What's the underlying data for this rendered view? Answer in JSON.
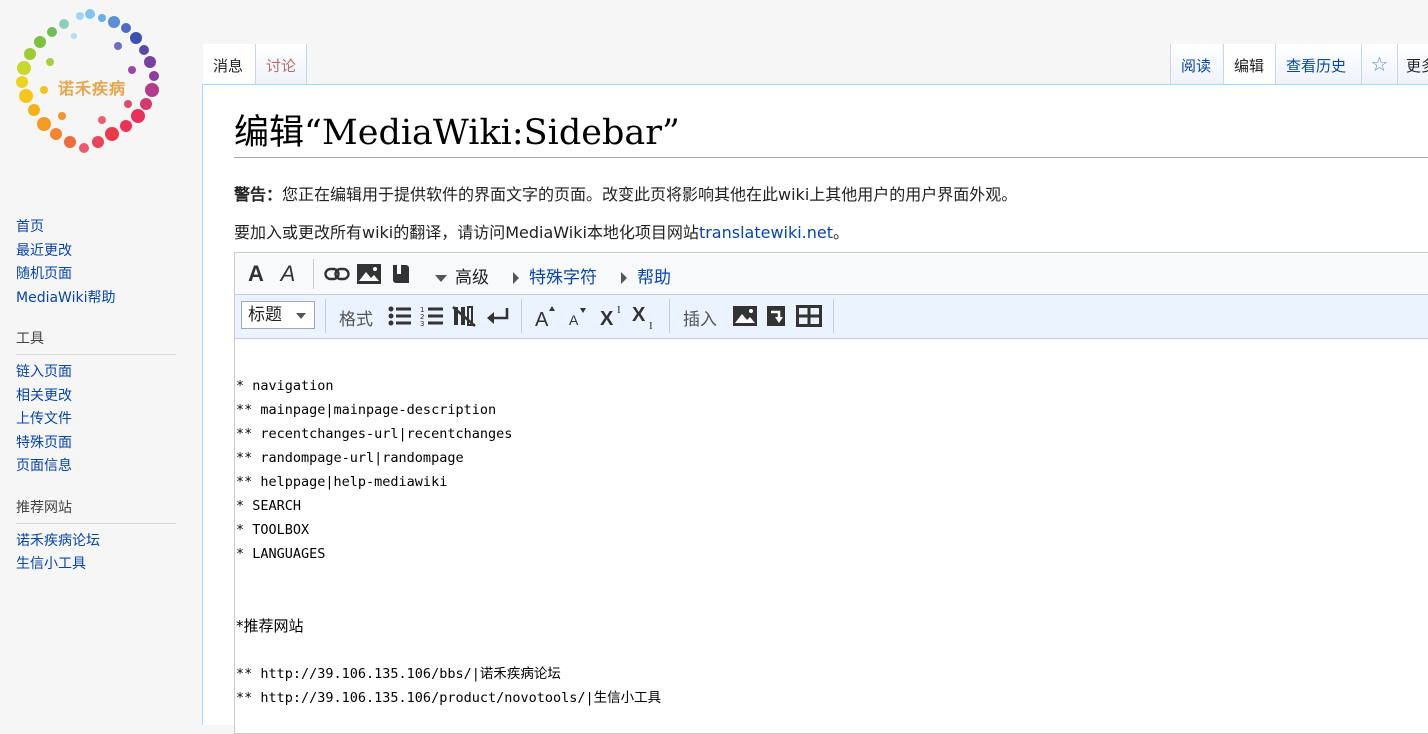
{
  "logo": {
    "text": "诺禾疾病"
  },
  "sidebar": {
    "navigation": [
      {
        "label": "首页"
      },
      {
        "label": "最近更改"
      },
      {
        "label": "随机页面"
      },
      {
        "label": "MediaWiki帮助"
      }
    ],
    "tools": {
      "heading": "工具",
      "items": [
        {
          "label": "链入页面"
        },
        {
          "label": "相关更改"
        },
        {
          "label": "上传文件"
        },
        {
          "label": "特殊页面"
        },
        {
          "label": "页面信息"
        }
      ]
    },
    "sites": {
      "heading": "推荐网站",
      "items": [
        {
          "label": "诺禾疾病论坛"
        },
        {
          "label": "生信小工具"
        }
      ]
    }
  },
  "tabs": {
    "page": "消息",
    "talk": "讨论",
    "read": "阅读",
    "edit": "编辑",
    "history": "查看历史",
    "watch_icon": "star-outline",
    "more": "更多"
  },
  "page": {
    "title": "编辑“MediaWiki:Sidebar”",
    "warning_label": "警告：",
    "warning_text": "您正在编辑用于提供软件的界面文字的页面。改变此页将影响其他在此wiki上其他用户的用户界面外观。",
    "translate_text": "要加入或更改所有wiki的翻译，请访问MediaWiki本地化项目网站",
    "translate_link": "translatewiki.net",
    "translate_suffix": "。"
  },
  "editor": {
    "toolbar1": {
      "bold_icon": "bold",
      "italic_icon": "italic",
      "link_icon": "link",
      "image_icon": "image",
      "reference_icon": "book",
      "advanced": "高级",
      "special_chars": "特殊字符",
      "help": "帮助"
    },
    "toolbar2": {
      "heading_select": "标题",
      "format_label": "格式",
      "insert_label": "插入"
    },
    "lines": [
      "* navigation",
      "** mainpage|mainpage-description",
      "** recentchanges-url|recentchanges",
      "** randompage-url|randompage",
      "** helppage|help-mediawiki",
      "* SEARCH",
      "* TOOLBOX",
      "* LANGUAGES",
      "",
      "",
      "*推荐网站",
      "",
      "** http://39.106.135.106/bbs/|诺禾疾病论坛",
      "** http://39.106.135.106/product/novotools/|生信小工具"
    ]
  },
  "colors": {
    "link": "#0645ad",
    "talk_link": "#ba6b6b",
    "border": "#a7d7f9",
    "toolbar2_bg": "#eaf3ff"
  }
}
